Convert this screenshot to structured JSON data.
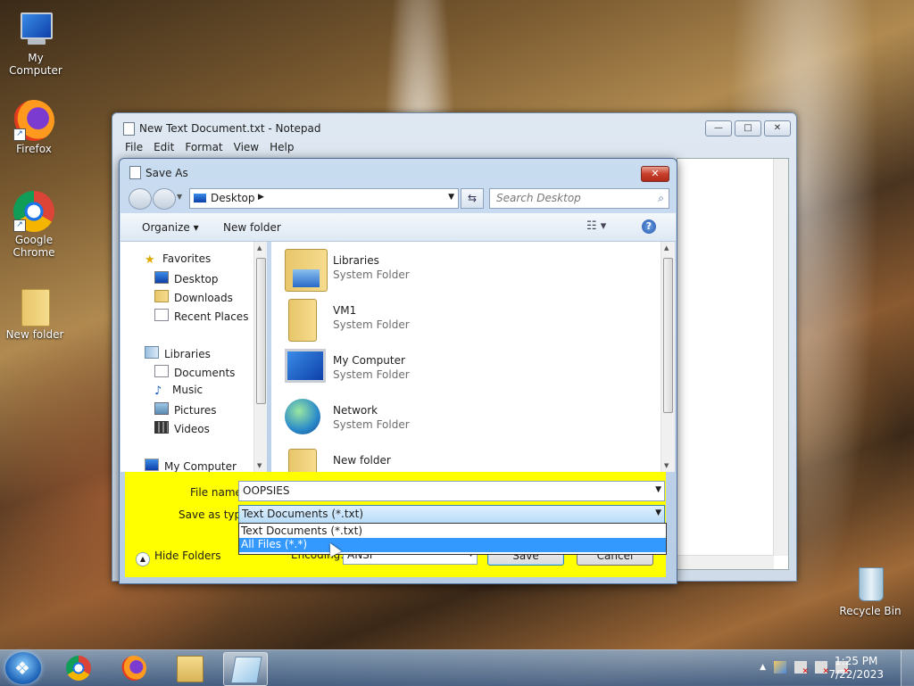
{
  "desktop": {
    "icons": [
      {
        "label": "My Computer"
      },
      {
        "label": "Firefox"
      },
      {
        "label": "Google Chrome"
      },
      {
        "label": "New folder"
      },
      {
        "label": "Recycle Bin"
      }
    ]
  },
  "notepad": {
    "title": "New Text Document.txt - Notepad",
    "menu": [
      "File",
      "Edit",
      "Format",
      "View",
      "Help"
    ],
    "controls": {
      "minimize": "—",
      "maximize": "□",
      "close": "✕"
    }
  },
  "save_dialog": {
    "title": "Save As",
    "close": "✕",
    "address": {
      "location": "Desktop"
    },
    "search_placeholder": "Search Desktop",
    "toolbar": {
      "organize": "Organize ▾",
      "new_folder": "New folder",
      "view": "☷ ▾",
      "help": "?"
    },
    "nav": {
      "favorites": "Favorites",
      "favorites_items": [
        "Desktop",
        "Downloads",
        "Recent Places"
      ],
      "libraries": "Libraries",
      "libraries_items": [
        "Documents",
        "Music",
        "Pictures",
        "Videos"
      ],
      "my_computer": "My Computer"
    },
    "files": [
      {
        "name": "Libraries",
        "type": "System Folder"
      },
      {
        "name": "VM1",
        "type": "System Folder"
      },
      {
        "name": "My Computer",
        "type": "System Folder"
      },
      {
        "name": "Network",
        "type": "System Folder"
      },
      {
        "name": "New folder",
        "type": ""
      }
    ],
    "file_name_label": "File name:",
    "file_name_value": "OOPSIES",
    "save_type_label": "Save as type:",
    "save_type_value": "Text Documents (*.txt)",
    "save_type_options": [
      "Text Documents (*.txt)",
      "All Files  (*.*)"
    ],
    "hide_folders": "Hide Folders",
    "encoding_label": "Encoding:",
    "encoding_value": "ANSI",
    "save_button": "Save",
    "cancel_button": "Cancel"
  },
  "taskbar": {
    "clock_time": "1:25 PM",
    "clock_date": "7/22/2023"
  },
  "colors": {
    "highlight": "#ffff00",
    "selection": "#3399ff"
  }
}
